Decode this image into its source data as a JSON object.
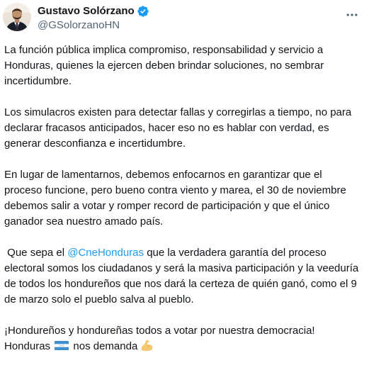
{
  "author": {
    "display_name": "Gustavo Solórzano",
    "handle": "@GSolorzanoHN",
    "verified": true,
    "avatar_icon": "profile-photo"
  },
  "menu": {
    "icon": "more-horizontal-icon"
  },
  "post": {
    "p1": "La función pública implica compromiso, responsabilidad y servicio a Honduras, quienes la ejercen deben brindar soluciones, no sembrar incertidumbre.",
    "p2": "Los simulacros existen para detectar fallas y corregirlas a tiempo, no para declarar fracasos anticipados, hacer eso no es hablar con verdad, es generar desconfianza e incertidumbre.",
    "p3": "En lugar de lamentarnos, debemos enfocarnos en garantizar que el proceso funcione, pero bueno contra viento y marea, el 30 de noviembre debemos salir a votar y romper record de participación y que el único ganador sea nuestro amado país.",
    "p4_before": " Que sepa el ",
    "p4_mention": "@CneHonduras",
    "p4_after": " que la verdadera garantía del proceso electoral somos los ciudadanos y será la masiva participación y la veeduría de todos los hondureños que nos dará la certeza de quién ganó, como el 9 de marzo solo el pueblo salva al pueblo.",
    "p5_line1": "¡Hondureños y hondureñas todos a votar por nuestra democracia!",
    "p5_before_flag": "Honduras ",
    "p5_after_flag": " nos demanda",
    "emoji_flag": "honduras-flag-icon",
    "emoji_muscle": "flexed-biceps-icon"
  },
  "colors": {
    "text": "#0f1419",
    "secondary": "#536471",
    "link": "#1d9bf0",
    "verified": "#1d9bf0"
  }
}
